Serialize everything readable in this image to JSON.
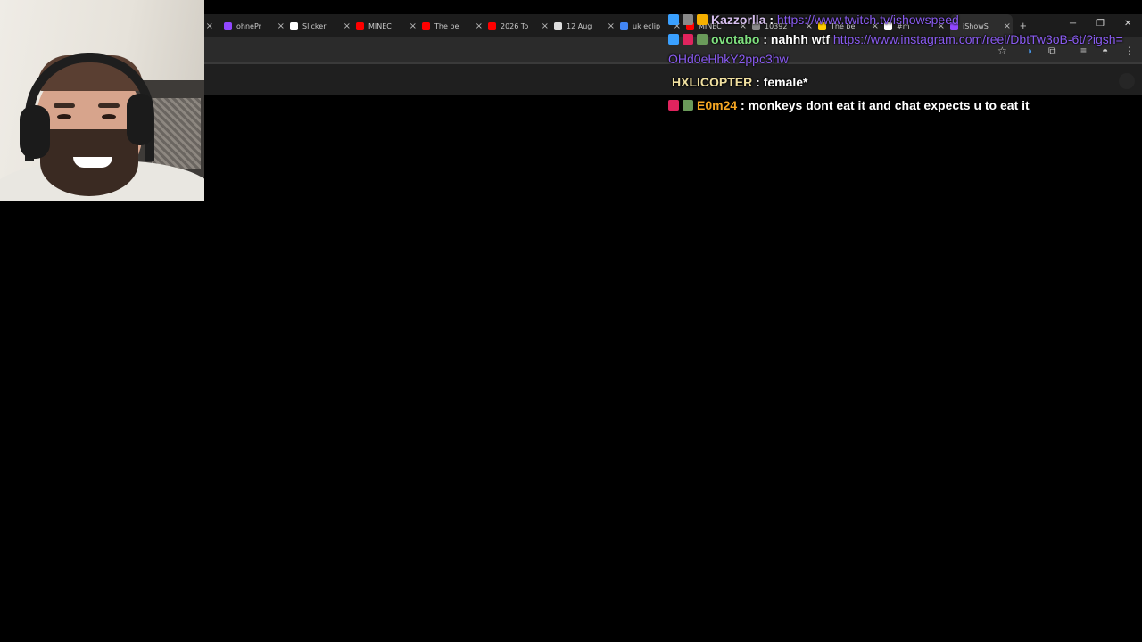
{
  "browser": {
    "tabs": [
      {
        "title": "ohnePr",
        "favicon_color": "#9147ff"
      },
      {
        "title": "Slicker",
        "favicon_color": "#ffffff"
      },
      {
        "title": "MINEC",
        "favicon_color": "#ff0000"
      },
      {
        "title": "The be",
        "favicon_color": "#ff0000"
      },
      {
        "title": "2026 To",
        "favicon_color": "#ff0000"
      },
      {
        "title": "12 Aug",
        "favicon_color": "#dddddd"
      },
      {
        "title": "uk eclip",
        "favicon_color": "#4285f4"
      },
      {
        "title": "MINEC",
        "favicon_color": "#ff0000"
      },
      {
        "title": "10392",
        "favicon_color": "#888888"
      },
      {
        "title": "The be",
        "favicon_color": "#ffcc00"
      },
      {
        "title": "#m",
        "favicon_color": "#ffffff"
      },
      {
        "title": "iShowS",
        "favicon_color": "#9147ff",
        "active": true
      }
    ],
    "new_tab_label": "+",
    "window_controls": {
      "minimize": "─",
      "restore": "❐",
      "close": "✕"
    },
    "tab_close_label": "×"
  },
  "chat": {
    "messages": [
      {
        "badges": [
          "#3aa0ff",
          "#8a8a8a",
          "#f5b000"
        ],
        "user": "Kazzorlla",
        "user_color": "#d8c0f0",
        "sep": ":",
        "text": "",
        "link": "https://www.twitch.tv/ishowspeed"
      },
      {
        "badges": [
          "#3aa0ff",
          "#e0245e",
          "#6a9a5a"
        ],
        "user": "ovotabo",
        "user_color": "#7fe07f",
        "sep": ":",
        "text": "nahhh wtf",
        "link": "https://www.instagram.com/reel/DbtTw3oB-6t/?igsh=OHd0eHhkY2ppc3hw"
      },
      {
        "badges": [],
        "user": "HXLICOPTER",
        "user_color": "#f0e0a0",
        "sep": ":",
        "text": "female*",
        "link": ""
      },
      {
        "badges": [
          "#e0245e",
          "#6a9a5a"
        ],
        "user": "E0m24",
        "user_color": "#f5a623",
        "sep": ":",
        "text": "monkeys dont eat it and chat expects u to eat it",
        "link": ""
      }
    ]
  },
  "colors": {
    "accent_link": "#8a5cf0",
    "background": "#000000"
  }
}
